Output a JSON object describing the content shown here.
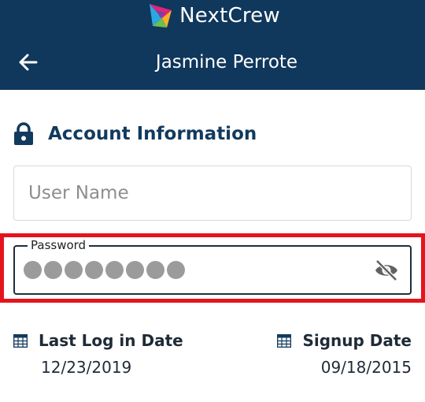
{
  "header": {
    "brand_name": "NextCrew",
    "title": "Jasmine Perrote",
    "background_color": "#10375c"
  },
  "account": {
    "section_title": "Account Information",
    "username": {
      "placeholder": "User Name",
      "value": ""
    },
    "password": {
      "label": "Password",
      "masked_char_count": 8,
      "visibility": "hidden"
    }
  },
  "dates": {
    "last_login": {
      "label": "Last Log in Date",
      "value": "12/23/2019"
    },
    "signup": {
      "label": "Signup Date",
      "value": "09/18/2015"
    }
  },
  "highlight_color": "#e5141c"
}
